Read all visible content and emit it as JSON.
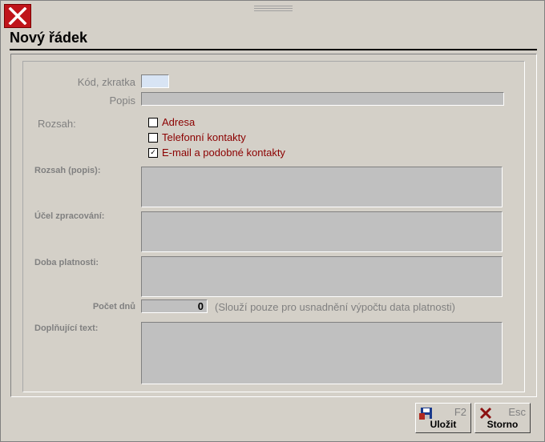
{
  "window": {
    "title": "Nový řádek"
  },
  "form": {
    "kod_label": "Kód, zkratka",
    "kod_value": "",
    "popis_label": "Popis",
    "popis_value": "",
    "rozsah_label": "Rozsah:",
    "checkboxes": [
      {
        "label": "Adresa",
        "checked": false
      },
      {
        "label": "Telefonní kontakty",
        "checked": false
      },
      {
        "label": "E-mail a podobné kontakty",
        "checked": true
      }
    ],
    "rozsah_popis_label": "Rozsah (popis):",
    "ucel_label": "Účel zpracování:",
    "doba_label": "Doba platnosti:",
    "pocet_label": "Počet dnů",
    "pocet_value": "0",
    "pocet_hint": "(Slouží pouze pro usnadnění výpočtu data platnosti)",
    "doplnujici_label": "Doplňující text:"
  },
  "buttons": {
    "save": {
      "key": "F2",
      "label": "Uložit",
      "icon": "save-icon"
    },
    "cancel": {
      "key": "Esc",
      "label": "Storno",
      "icon": "cancel-x-icon"
    }
  },
  "colors": {
    "close": "#c0141a",
    "checkbox_text": "#8b0000",
    "active_field": "#d8e4f4"
  }
}
